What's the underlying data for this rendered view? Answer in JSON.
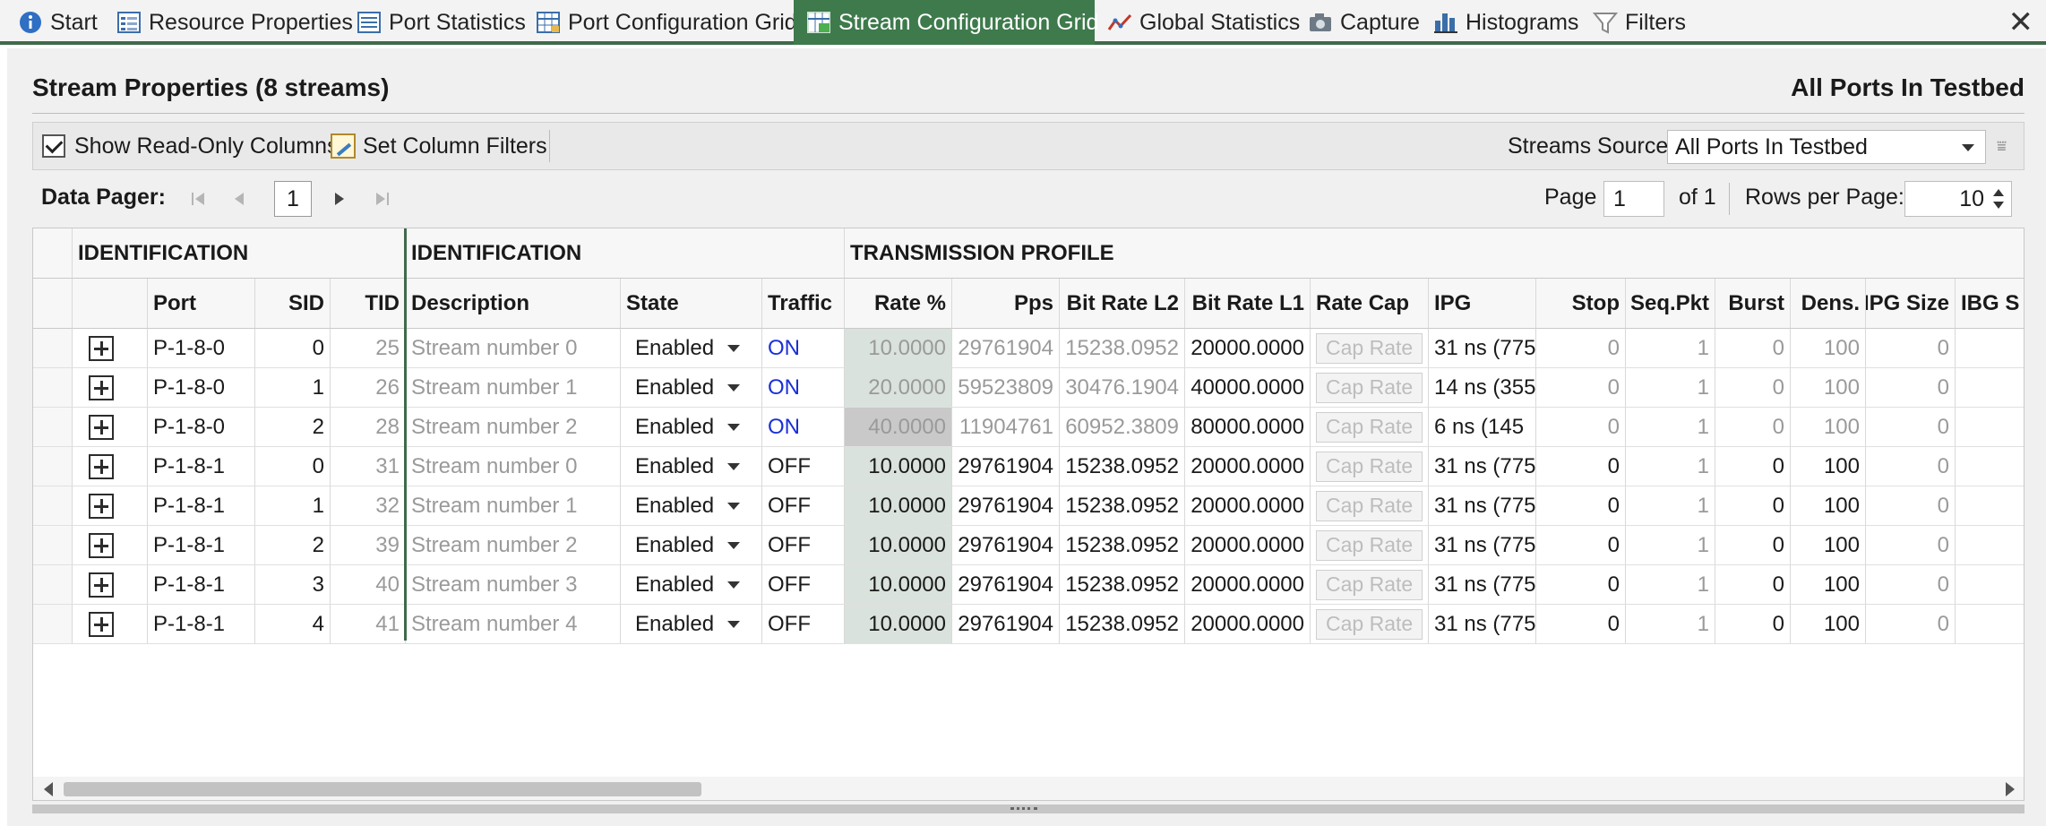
{
  "tabs": [
    {
      "label": "Start",
      "icon": "info-icon"
    },
    {
      "label": "Resource Properties",
      "icon": "properties-icon"
    },
    {
      "label": "Port Statistics",
      "icon": "statistics-icon"
    },
    {
      "label": "Port Configuration Grid",
      "icon": "grid-icon"
    },
    {
      "label": "Stream Configuration Grid",
      "icon": "stream-grid-icon",
      "active": true
    },
    {
      "label": "Global Statistics",
      "icon": "line-chart-icon"
    },
    {
      "label": "Capture",
      "icon": "camera-icon"
    },
    {
      "label": "Histograms",
      "icon": "histogram-icon"
    },
    {
      "label": "Filters",
      "icon": "funnel-icon"
    }
  ],
  "panel": {
    "title": "Stream Properties (8 streams)",
    "title_right": "All Ports In Testbed"
  },
  "toolbar": {
    "show_readonly_label": "Show Read-Only Columns",
    "show_readonly_checked": true,
    "set_filters_label": "Set Column Filters",
    "streams_source_label": "Streams Source:",
    "streams_source_value": "All Ports In Testbed"
  },
  "pager": {
    "label": "Data Pager:",
    "current_page_button": "1",
    "page_label": "Page",
    "page_value": "1",
    "of_label": "of 1",
    "rows_per_page_label": "Rows per Page:",
    "rows_per_page_value": "10"
  },
  "grid": {
    "groups": [
      "IDENTIFICATION",
      "IDENTIFICATION",
      "TRANSMISSION PROFILE"
    ],
    "columns": [
      "Port",
      "SID",
      "TID",
      "Description",
      "State",
      "Traffic",
      "Rate %",
      "Pps",
      "Bit Rate L2",
      "Bit Rate L1",
      "Rate Cap",
      "IPG",
      "Stop",
      "Seq.Pkt",
      "Burst",
      "Dens.",
      "IPG Size",
      "IBG S"
    ],
    "cap_button_label": "Cap Rate",
    "rows": [
      {
        "port": "P-1-8-0",
        "sid": "0",
        "tid": "25",
        "desc": "Stream number 0",
        "state": "Enabled",
        "traffic": "ON",
        "rate": "10.0000",
        "pps": "29761904",
        "l2": "15238.0952",
        "l1": "20000.0000",
        "ipg": "31 ns (775",
        "stop": "0",
        "seq": "1",
        "burst": "0",
        "dens": "100",
        "ipgsize": "0"
      },
      {
        "port": "P-1-8-0",
        "sid": "1",
        "tid": "26",
        "desc": "Stream number 1",
        "state": "Enabled",
        "traffic": "ON",
        "rate": "20.0000",
        "pps": "59523809",
        "l2": "30476.1904",
        "l1": "40000.0000",
        "ipg": "14 ns (355",
        "stop": "0",
        "seq": "1",
        "burst": "0",
        "dens": "100",
        "ipgsize": "0"
      },
      {
        "port": "P-1-8-0",
        "sid": "2",
        "tid": "28",
        "desc": "Stream number 2",
        "state": "Enabled",
        "traffic": "ON",
        "rate": "40.0000",
        "pps": "11904761",
        "l2": "60952.3809",
        "l1": "80000.0000",
        "ipg": "6 ns (145",
        "stop": "0",
        "seq": "1",
        "burst": "0",
        "dens": "100",
        "ipgsize": "0"
      },
      {
        "port": "P-1-8-1",
        "sid": "0",
        "tid": "31",
        "desc": "Stream number 0",
        "state": "Enabled",
        "traffic": "OFF",
        "rate": "10.0000",
        "pps": "29761904",
        "l2": "15238.0952",
        "l1": "20000.0000",
        "ipg": "31 ns (775",
        "stop": "0",
        "seq": "1",
        "burst": "0",
        "dens": "100",
        "ipgsize": "0"
      },
      {
        "port": "P-1-8-1",
        "sid": "1",
        "tid": "32",
        "desc": "Stream number 1",
        "state": "Enabled",
        "traffic": "OFF",
        "rate": "10.0000",
        "pps": "29761904",
        "l2": "15238.0952",
        "l1": "20000.0000",
        "ipg": "31 ns (775",
        "stop": "0",
        "seq": "1",
        "burst": "0",
        "dens": "100",
        "ipgsize": "0"
      },
      {
        "port": "P-1-8-1",
        "sid": "2",
        "tid": "39",
        "desc": "Stream number 2",
        "state": "Enabled",
        "traffic": "OFF",
        "rate": "10.0000",
        "pps": "29761904",
        "l2": "15238.0952",
        "l1": "20000.0000",
        "ipg": "31 ns (775",
        "stop": "0",
        "seq": "1",
        "burst": "0",
        "dens": "100",
        "ipgsize": "0"
      },
      {
        "port": "P-1-8-1",
        "sid": "3",
        "tid": "40",
        "desc": "Stream number 3",
        "state": "Enabled",
        "traffic": "OFF",
        "rate": "10.0000",
        "pps": "29761904",
        "l2": "15238.0952",
        "l1": "20000.0000",
        "ipg": "31 ns (775",
        "stop": "0",
        "seq": "1",
        "burst": "0",
        "dens": "100",
        "ipgsize": "0"
      },
      {
        "port": "P-1-8-1",
        "sid": "4",
        "tid": "41",
        "desc": "Stream number 4",
        "state": "Enabled",
        "traffic": "OFF",
        "rate": "10.0000",
        "pps": "29761904",
        "l2": "15238.0952",
        "l1": "20000.0000",
        "ipg": "31 ns (775",
        "stop": "0",
        "seq": "1",
        "burst": "0",
        "dens": "100",
        "ipgsize": "0"
      }
    ]
  }
}
